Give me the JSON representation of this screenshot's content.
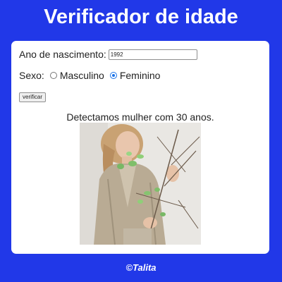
{
  "header": {
    "title": "Verificador de idade"
  },
  "form": {
    "birth_year_label": "Ano de nascimento:",
    "birth_year_value": "1992",
    "sex_label": "Sexo:",
    "sex_options": [
      {
        "label": "Masculino",
        "checked": false
      },
      {
        "label": "Feminino",
        "checked": true
      }
    ],
    "verify_button_label": "verificar"
  },
  "result": {
    "message": "Detectamos mulher com 30 anos.",
    "image_icon": "woman-photo"
  },
  "footer": {
    "text": "©Talita"
  },
  "colors": {
    "background": "#2138e8",
    "card": "#ffffff",
    "radio_accent": "#1a73e8"
  }
}
